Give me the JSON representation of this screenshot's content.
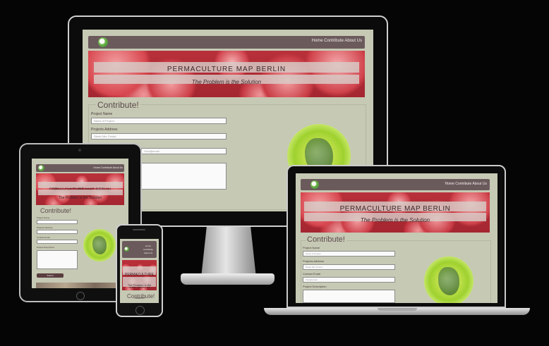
{
  "site": {
    "nav_links": "Home  Contribute  About Us",
    "nav_links_phone": "Home Contribute About Us",
    "title": "PERMACULTURE MAP BERLIN",
    "title_phone": "PERMACULTURE MAP BERLIN",
    "subtitle": "The Problem is the Solution",
    "subtitle_phone": "The Problem is the Solution",
    "contribute_heading": "Contribute!",
    "contribute_heading_phone": "Contribute!",
    "form": {
      "project_name_label": "Project Name",
      "project_name_placeholder": "Name of Project",
      "address_label": "Projects Address",
      "address_placeholder": "Street Nbr. Postal",
      "email_label": "Contact Email",
      "email_placeholder": "Your@email",
      "description_label": "Project Description",
      "submit_label": "Submit"
    }
  },
  "colors": {
    "page_bg": "#c6c9b4",
    "nav_bg": "#6b5a5c",
    "accent": "#5a3d3f"
  }
}
